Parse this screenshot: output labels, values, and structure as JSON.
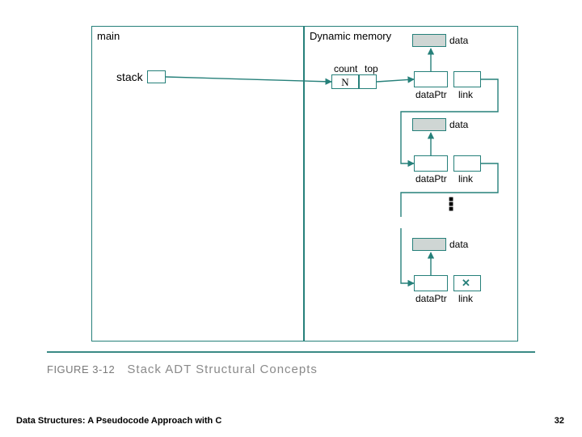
{
  "panels": {
    "main_title": "main",
    "dyn_title": "Dynamic memory"
  },
  "labels": {
    "stack": "stack",
    "count": "count",
    "top": "top",
    "N": "N",
    "data": "data",
    "dataPtr": "dataPtr",
    "link": "link"
  },
  "figure": {
    "number": "FIGURE 3-12",
    "title": "Stack ADT Structural Concepts"
  },
  "footer": {
    "book": "Data Structures: A Pseudocode Approach with C",
    "page": "32"
  },
  "colors": {
    "teal": "#26807a"
  }
}
